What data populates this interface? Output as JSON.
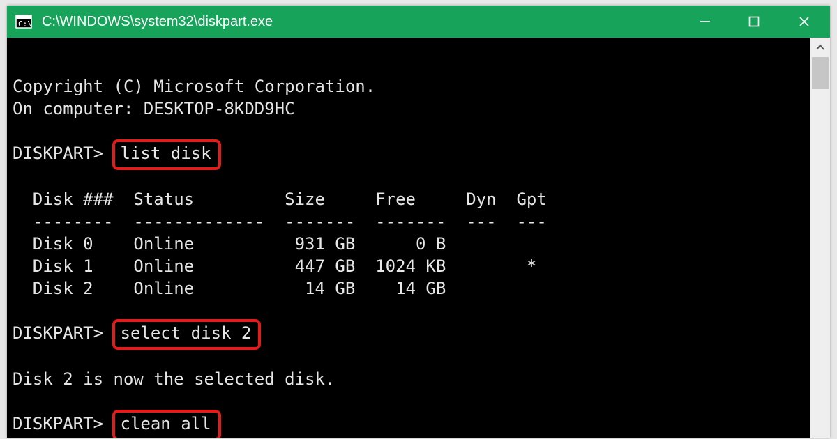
{
  "window": {
    "title": "C:\\WINDOWS\\system32\\diskpart.exe"
  },
  "terminal": {
    "copyright": "Copyright (C) Microsoft Corporation.",
    "computer_line_prefix": "On computer: ",
    "computer_name": "DESKTOP-8KDD9HC",
    "prompt": "DISKPART>",
    "cmd1": "list disk",
    "cmd2": "select disk 2",
    "cmd3": "clean all",
    "selected_msg": "Disk 2 is now the selected disk.",
    "table": {
      "header": "  Disk ###  Status         Size     Free     Dyn  Gpt",
      "divider": "  --------  -------------  -------  -------  ---  ---",
      "rows": [
        "  Disk 0    Online          931 GB      0 B",
        "  Disk 1    Online          447 GB  1024 KB        *",
        "  Disk 2    Online           14 GB    14 GB"
      ]
    }
  },
  "colors": {
    "titlebar": "#17a35a",
    "highlight_border": "#e21b1b"
  }
}
